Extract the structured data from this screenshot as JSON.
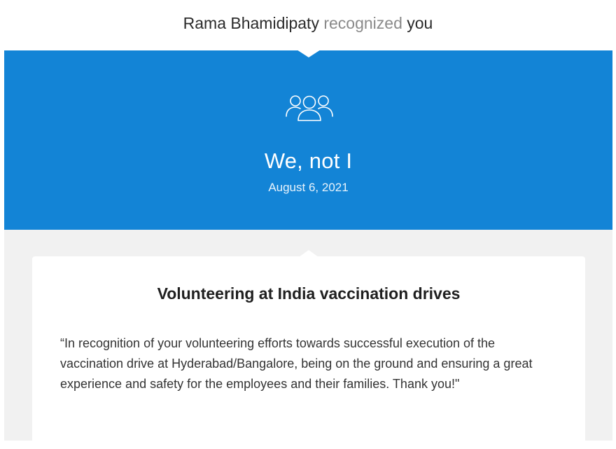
{
  "header": {
    "sender_name": "Rama Bhamidipaty",
    "action_text": "recognized",
    "recipient_text": "you"
  },
  "banner": {
    "icon": "people-group-icon",
    "title": "We, not I",
    "date": "August 6, 2021",
    "background_color": "#1384d6"
  },
  "card": {
    "title": "Volunteering at India vaccination drives",
    "message": "“In recognition of your volunteering efforts towards successful execution of the vaccination drive at Hyderabad/Bangalore, being on the ground and ensuring a great experience and safety for the employees and their families. Thank you!\""
  }
}
